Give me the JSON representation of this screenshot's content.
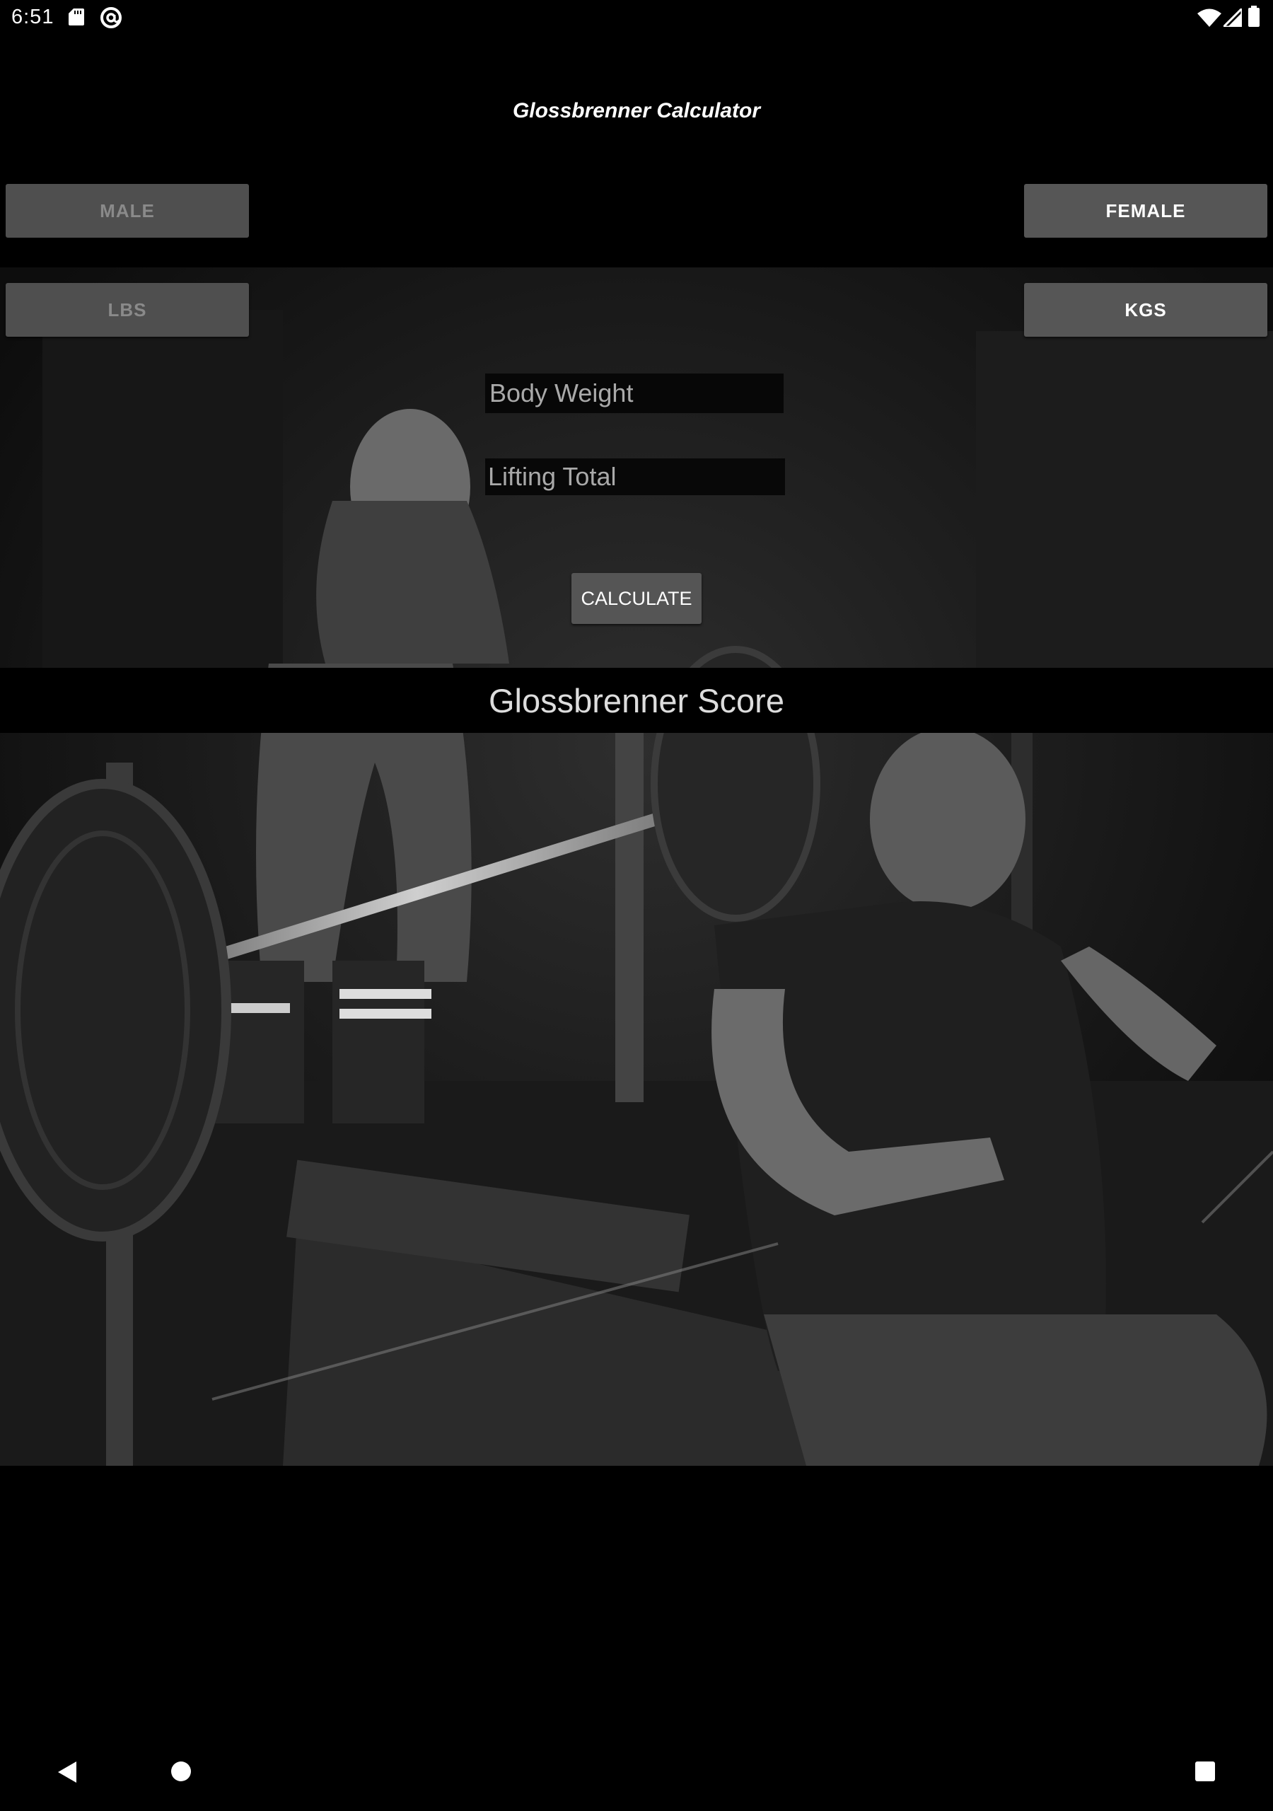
{
  "status_bar": {
    "time": "6:51",
    "icons": [
      "sd-card-icon",
      "at-sign-icon",
      "wifi-icon",
      "signal-icon",
      "battery-icon"
    ]
  },
  "header": {
    "title": "Glossbrenner Calculator"
  },
  "gender_toggle": {
    "male_label": "MALE",
    "female_label": "FEMALE",
    "selected": "FEMALE"
  },
  "unit_toggle": {
    "lbs_label": "LBS",
    "kgs_label": "KGS",
    "selected": "KGS"
  },
  "form": {
    "body_weight_placeholder": "Body Weight",
    "body_weight_value": "",
    "lifting_total_placeholder": "Lifting Total",
    "lifting_total_value": "",
    "calculate_label": "CALCULATE"
  },
  "result": {
    "score_label": "Glossbrenner Score"
  },
  "colors": {
    "background": "#000000",
    "button_bg": "#555555",
    "inactive_text": "#8a8a8a",
    "active_text": "#ffffff"
  },
  "nav_bar": {
    "icons": [
      "back-icon",
      "home-icon",
      "recents-icon"
    ]
  }
}
